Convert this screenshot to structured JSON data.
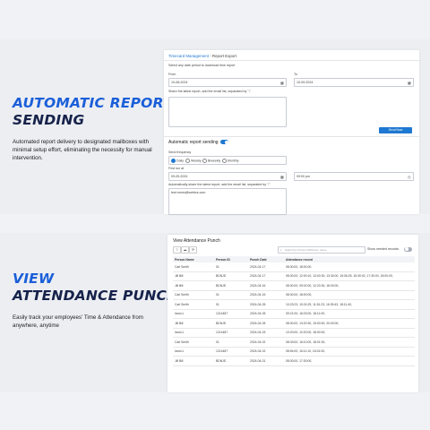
{
  "section1": {
    "heading_line1": "AUTOMATIC REPORT",
    "heading_line2": "SENDING",
    "description": "Automated report delivery to designated mailboxes with minimal setup effort, eliminating the necessity for manual intervention."
  },
  "section2": {
    "heading_line1": "VIEW",
    "heading_line2": "ATTENDANCE PUNCH",
    "description": "Easily track your employees' Time & Attendance from anywhere, anytime"
  },
  "report_panel": {
    "title_main": "Timecard Management",
    "title_sub": "- Report Export",
    "select_label": "Select any date period to download time report",
    "from_label": "From",
    "from_value": "10-08-2024",
    "to_label": "To",
    "to_value": "10-09-2024",
    "email_label": "Share the latest report, add the email list, separated by \";\"",
    "send_button": "Send Now",
    "auto_label": "Automatic report sending",
    "frequency_label": "Send frequency",
    "frequency_options": [
      "Daily",
      "Weekly",
      "Biweekly",
      "Monthly"
    ],
    "first_run_label": "First run at",
    "first_run_date": "09-09-2024",
    "first_run_time": "09:00 pm",
    "auto_email_label": "Automatically share the latest report, add the email list, separated by \";\"",
    "auto_email_value": "test.mmm@webtcs.com"
  },
  "punch_panel": {
    "title": "View Attendance Punch",
    "search_placeholder": "Search by Person ID/Person name",
    "show_needed_label": "Show needed records",
    "columns": [
      "Person Name",
      "Person ID",
      "Punch Date",
      "Attendance record"
    ],
    "rows": [
      [
        "Carl Smith",
        "01",
        "2024-04-17",
        "08:30:00, 18:00:00,"
      ],
      [
        "Jill Bill",
        "BDNJE.",
        "2024-04-17",
        "08:30:00, 12:00:10, 13:00:30, 13:30:00, 15:06:25, 15:30:02, 17:30:00, 18:00:00,"
      ],
      [
        "Jill Bill",
        "BDNJE.",
        "2024-04-16",
        "08:30:00, 09:02:00, 12:20:30, 18:00:00,"
      ],
      [
        "Carl Smith",
        "01",
        "2024-04-15",
        "08:30:00, 18:00:00,"
      ],
      [
        "Carl Smith",
        "01",
        "2024-04-05",
        "10:23:23, 10:24:29, 11:51:23, 16:39:43, 18:11:40,"
      ],
      [
        "Iana Li",
        "1214487",
        "2024-04-05",
        "09:21:00, 16:03:00, 18:11:00,"
      ],
      [
        "Jill Bill",
        "BDNJE.",
        "2024-04-05",
        "08:30:00, 13:20:30, 15:00:00, 20:00:00,"
      ],
      [
        "Iana Li",
        "1214487",
        "2024-04-03",
        "10:20:00, 10:20:00, 18:00:00,"
      ],
      [
        "Carl Smith",
        "01",
        "2024-04-02",
        "08:33:00, 16:10:00, 18:01:00,"
      ],
      [
        "Iana Li",
        "1214487",
        "2024-04-02",
        "08:54:00, 16:11:10, 18:31:00,"
      ],
      [
        "Jill Bill",
        "BDNJE.",
        "2024-04-01",
        "08:30:00, 17:30:00,"
      ]
    ]
  },
  "colors": {
    "accent_blue": "#1b5fd9",
    "heading_dark": "#16224a",
    "button_blue": "#1f78d1"
  }
}
